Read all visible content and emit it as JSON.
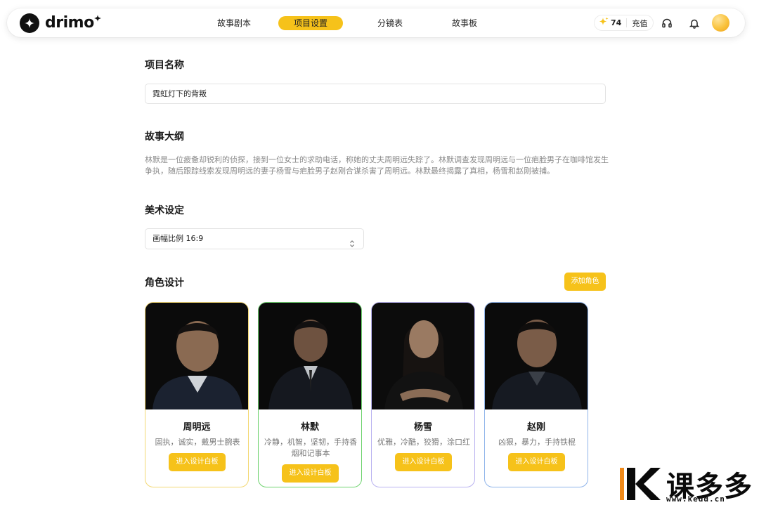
{
  "app": {
    "logo_text": "drimo"
  },
  "nav": {
    "tabs": [
      {
        "label": "故事剧本"
      },
      {
        "label": "项目设置",
        "active": true
      },
      {
        "label": "分镜表"
      },
      {
        "label": "故事板"
      }
    ]
  },
  "header": {
    "credits": "74",
    "recharge_label": "充值",
    "icons": [
      "sparkle-icon",
      "headset-icon",
      "bell-icon"
    ]
  },
  "project": {
    "name_label": "项目名称",
    "name_value": "霓虹灯下的背叛",
    "outline_label": "故事大纲",
    "outline_text": "林默是一位疲惫却锐利的侦探，接到一位女士的求助电话，称她的丈夫周明远失踪了。林默调查发现周明远与一位疤脸男子在咖啡馆发生争执，随后跟踪线索发现周明远的妻子杨雪与疤脸男子赵刚合谋杀害了周明远。林默最终揭露了真相，杨雪和赵刚被捕。",
    "art_label": "美术设定",
    "ratio_value": "画幅比例 16:9"
  },
  "characters": {
    "section_label": "角色设计",
    "add_label": "添加角色",
    "enter_label": "进入设计白板",
    "items": [
      {
        "name": "周明远",
        "traits": "固执，诚实，戴男士腕表",
        "border": "#f3d873"
      },
      {
        "name": "林默",
        "traits": "冷静，机智，坚韧，手持香烟和记事本",
        "border": "#6fd36f"
      },
      {
        "name": "杨雪",
        "traits": "优雅，冷酷，狡猾，涂口红",
        "border": "#b9b2f0"
      },
      {
        "name": "赵刚",
        "traits": "凶狠，暴力，手持铁棍",
        "border": "#8fb4ea"
      }
    ]
  },
  "colors": {
    "accent": "#f6c21a"
  },
  "watermark": {
    "text": "课多多",
    "url": "www.kedd.cn"
  }
}
